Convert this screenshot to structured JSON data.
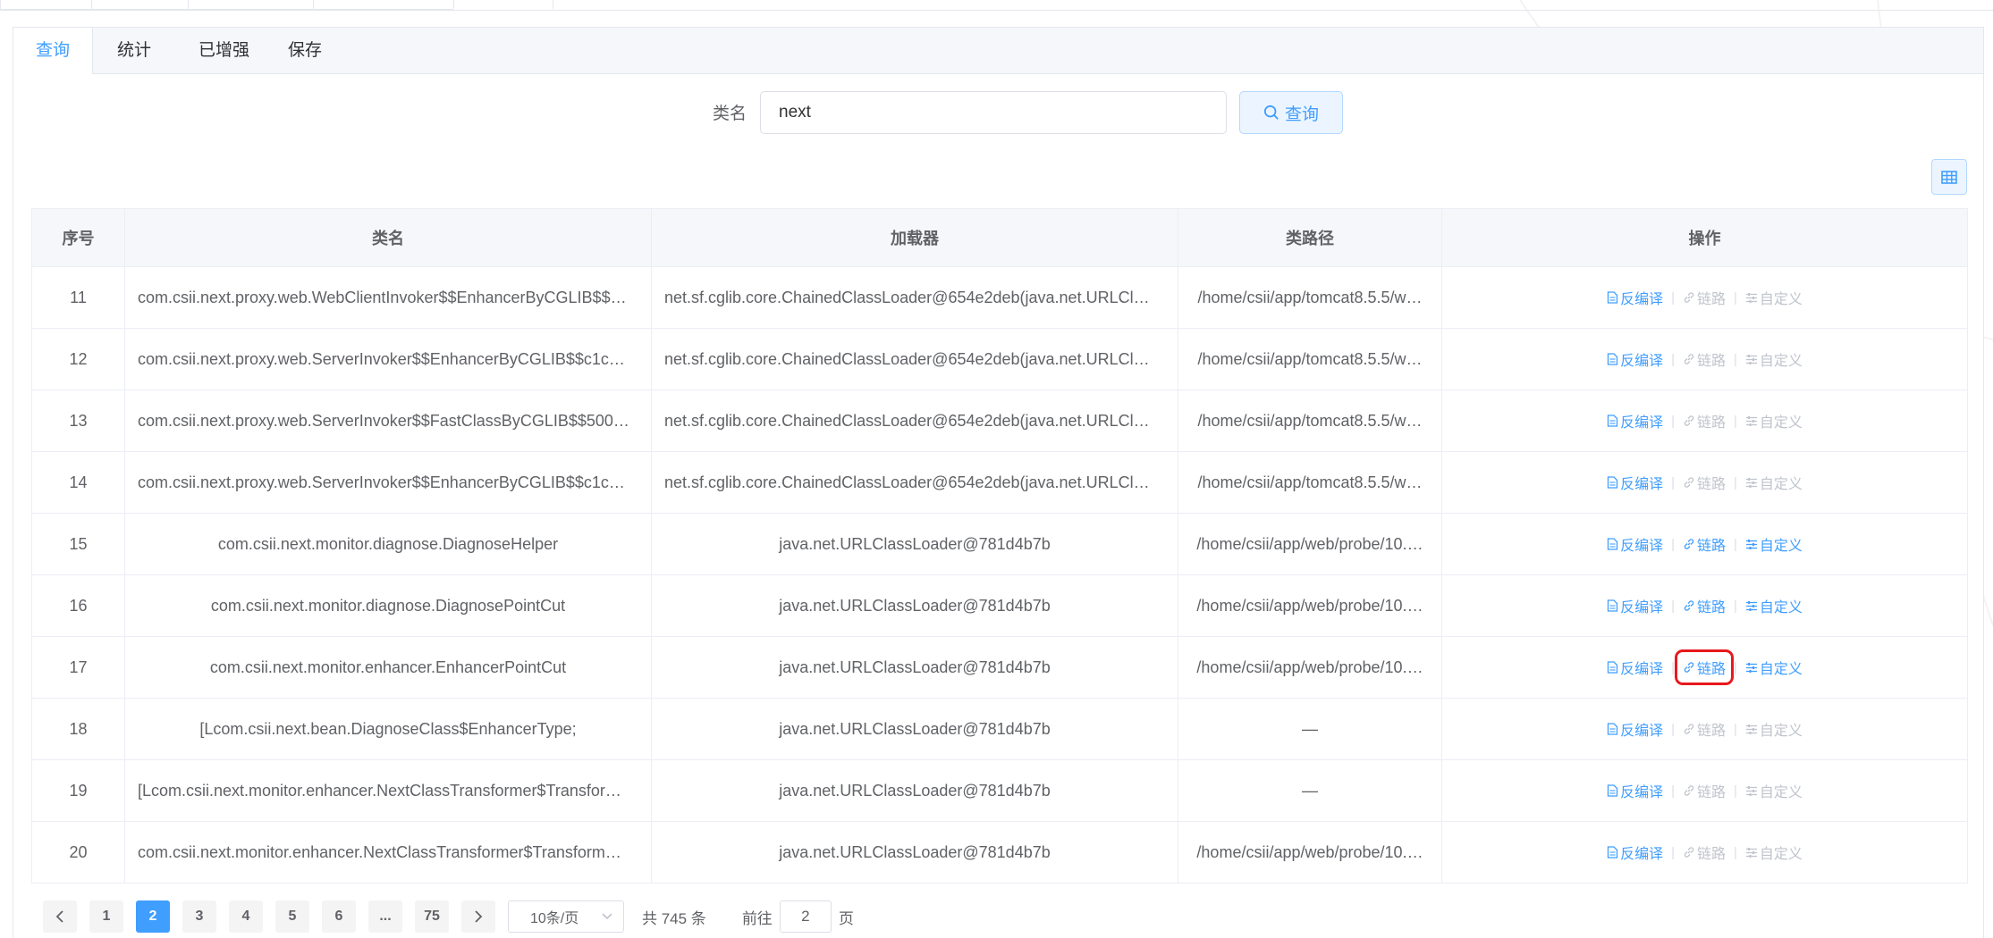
{
  "card_tabs": [
    "查询",
    "统计",
    "已增强",
    "保存"
  ],
  "search": {
    "label": "类名",
    "value": "next",
    "button": "查询"
  },
  "table": {
    "headers": [
      "序号",
      "类名",
      "加载器",
      "类路径",
      "操作"
    ],
    "rows": [
      {
        "index": "11",
        "class_name": "com.csii.next.proxy.web.WebClientInvoker$$EnhancerByCGLIB$$…",
        "loader": "net.sf.cglib.core.ChainedClassLoader@654e2deb(java.net.URLCl…",
        "path": "/home/csii/app/tomcat8.5.5/w…",
        "name_align": "left",
        "loader_align": "left",
        "ops_enabled": [
          true,
          false,
          false
        ]
      },
      {
        "index": "12",
        "class_name": "com.csii.next.proxy.web.ServerInvoker$$EnhancerByCGLIB$$c1c…",
        "loader": "net.sf.cglib.core.ChainedClassLoader@654e2deb(java.net.URLCl…",
        "path": "/home/csii/app/tomcat8.5.5/w…",
        "name_align": "left",
        "loader_align": "left",
        "ops_enabled": [
          true,
          false,
          false
        ]
      },
      {
        "index": "13",
        "class_name": "com.csii.next.proxy.web.ServerInvoker$$FastClassByCGLIB$$500…",
        "loader": "net.sf.cglib.core.ChainedClassLoader@654e2deb(java.net.URLCl…",
        "path": "/home/csii/app/tomcat8.5.5/w…",
        "name_align": "left",
        "loader_align": "left",
        "ops_enabled": [
          true,
          false,
          false
        ]
      },
      {
        "index": "14",
        "class_name": "com.csii.next.proxy.web.ServerInvoker$$EnhancerByCGLIB$$c1c…",
        "loader": "net.sf.cglib.core.ChainedClassLoader@654e2deb(java.net.URLCl…",
        "path": "/home/csii/app/tomcat8.5.5/w…",
        "name_align": "left",
        "loader_align": "left",
        "ops_enabled": [
          true,
          false,
          false
        ]
      },
      {
        "index": "15",
        "class_name": "com.csii.next.monitor.diagnose.DiagnoseHelper",
        "loader": "java.net.URLClassLoader@781d4b7b",
        "path": "/home/csii/app/web/probe/10.…",
        "name_align": "center",
        "loader_align": "center",
        "ops_enabled": [
          true,
          true,
          true
        ]
      },
      {
        "index": "16",
        "class_name": "com.csii.next.monitor.diagnose.DiagnosePointCut",
        "loader": "java.net.URLClassLoader@781d4b7b",
        "path": "/home/csii/app/web/probe/10.…",
        "name_align": "center",
        "loader_align": "center",
        "ops_enabled": [
          true,
          true,
          true
        ]
      },
      {
        "index": "17",
        "class_name": "com.csii.next.monitor.enhancer.EnhancerPointCut",
        "loader": "java.net.URLClassLoader@781d4b7b",
        "path": "/home/csii/app/web/probe/10.…",
        "name_align": "center",
        "loader_align": "center",
        "ops_enabled": [
          true,
          true,
          true
        ],
        "highlight_op": 1
      },
      {
        "index": "18",
        "class_name": "[Lcom.csii.next.bean.DiagnoseClass$EnhancerType;",
        "loader": "java.net.URLClassLoader@781d4b7b",
        "path": "—",
        "name_align": "center",
        "loader_align": "center",
        "ops_enabled": [
          true,
          false,
          false
        ]
      },
      {
        "index": "19",
        "class_name": "[Lcom.csii.next.monitor.enhancer.NextClassTransformer$Transfor…",
        "loader": "java.net.URLClassLoader@781d4b7b",
        "path": "—",
        "name_align": "left",
        "loader_align": "center",
        "ops_enabled": [
          true,
          false,
          false
        ]
      },
      {
        "index": "20",
        "class_name": "com.csii.next.monitor.enhancer.NextClassTransformer$Transform…",
        "loader": "java.net.URLClassLoader@781d4b7b",
        "path": "/home/csii/app/web/probe/10.…",
        "name_align": "left",
        "loader_align": "center",
        "ops_enabled": [
          true,
          false,
          false
        ]
      }
    ]
  },
  "op_labels": [
    "反编译",
    "链路",
    "自定义"
  ],
  "op_icons": [
    "document-icon",
    "link-icon",
    "sliders-icon"
  ],
  "pagination": {
    "pages": [
      "1",
      "2",
      "3",
      "4",
      "5",
      "6",
      "...",
      "75"
    ],
    "current": "2",
    "page_size": "10条/页",
    "total": "共 745 条",
    "jump_prefix": "前往",
    "jump_value": "2",
    "jump_suffix": "页"
  },
  "colors": {
    "primary": "#409eff",
    "disabled": "#c0c4cc",
    "highlight": "#e8191d"
  }
}
